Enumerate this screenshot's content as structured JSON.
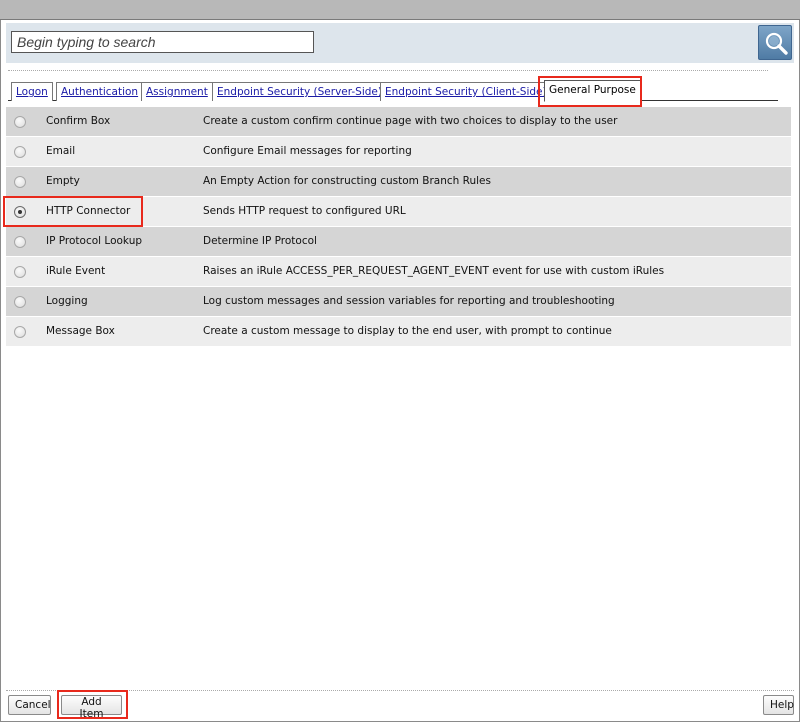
{
  "search": {
    "placeholder": "Begin typing to search"
  },
  "tabs": [
    {
      "label": "Logon",
      "active": false
    },
    {
      "label": "Authentication",
      "active": false
    },
    {
      "label": "Assignment",
      "active": false
    },
    {
      "label": "Endpoint Security (Server-Side)",
      "active": false
    },
    {
      "label": "Endpoint Security (Client-Side)",
      "active": false
    },
    {
      "label": "General Purpose",
      "active": true
    }
  ],
  "items": [
    {
      "name": "Confirm Box",
      "description": "Create a custom confirm continue page with two choices to display to the user",
      "selected": false
    },
    {
      "name": "Email",
      "description": "Configure Email messages for reporting",
      "selected": false
    },
    {
      "name": "Empty",
      "description": "An Empty Action for constructing custom Branch Rules",
      "selected": false
    },
    {
      "name": "HTTP Connector",
      "description": "Sends HTTP request to configured URL",
      "selected": true
    },
    {
      "name": "IP Protocol Lookup",
      "description": "Determine IP Protocol",
      "selected": false
    },
    {
      "name": "iRule Event",
      "description": "Raises an iRule ACCESS_PER_REQUEST_AGENT_EVENT event for use with custom iRules",
      "selected": false
    },
    {
      "name": "Logging",
      "description": "Log custom messages and session variables for reporting and troubleshooting",
      "selected": false
    },
    {
      "name": "Message Box",
      "description": "Create a custom message to display to the end user, with prompt to continue",
      "selected": false
    }
  ],
  "buttons": {
    "cancel": "Cancel",
    "add_item": "Add Item",
    "help": "Help"
  },
  "colors": {
    "highlight": "#e8291c",
    "row_dark": "#d5d5d5",
    "row_light": "#ededed",
    "search_bar": "#dde5ec",
    "link": "#1a1aa6"
  },
  "icons": {
    "search": "magnifier-icon"
  }
}
